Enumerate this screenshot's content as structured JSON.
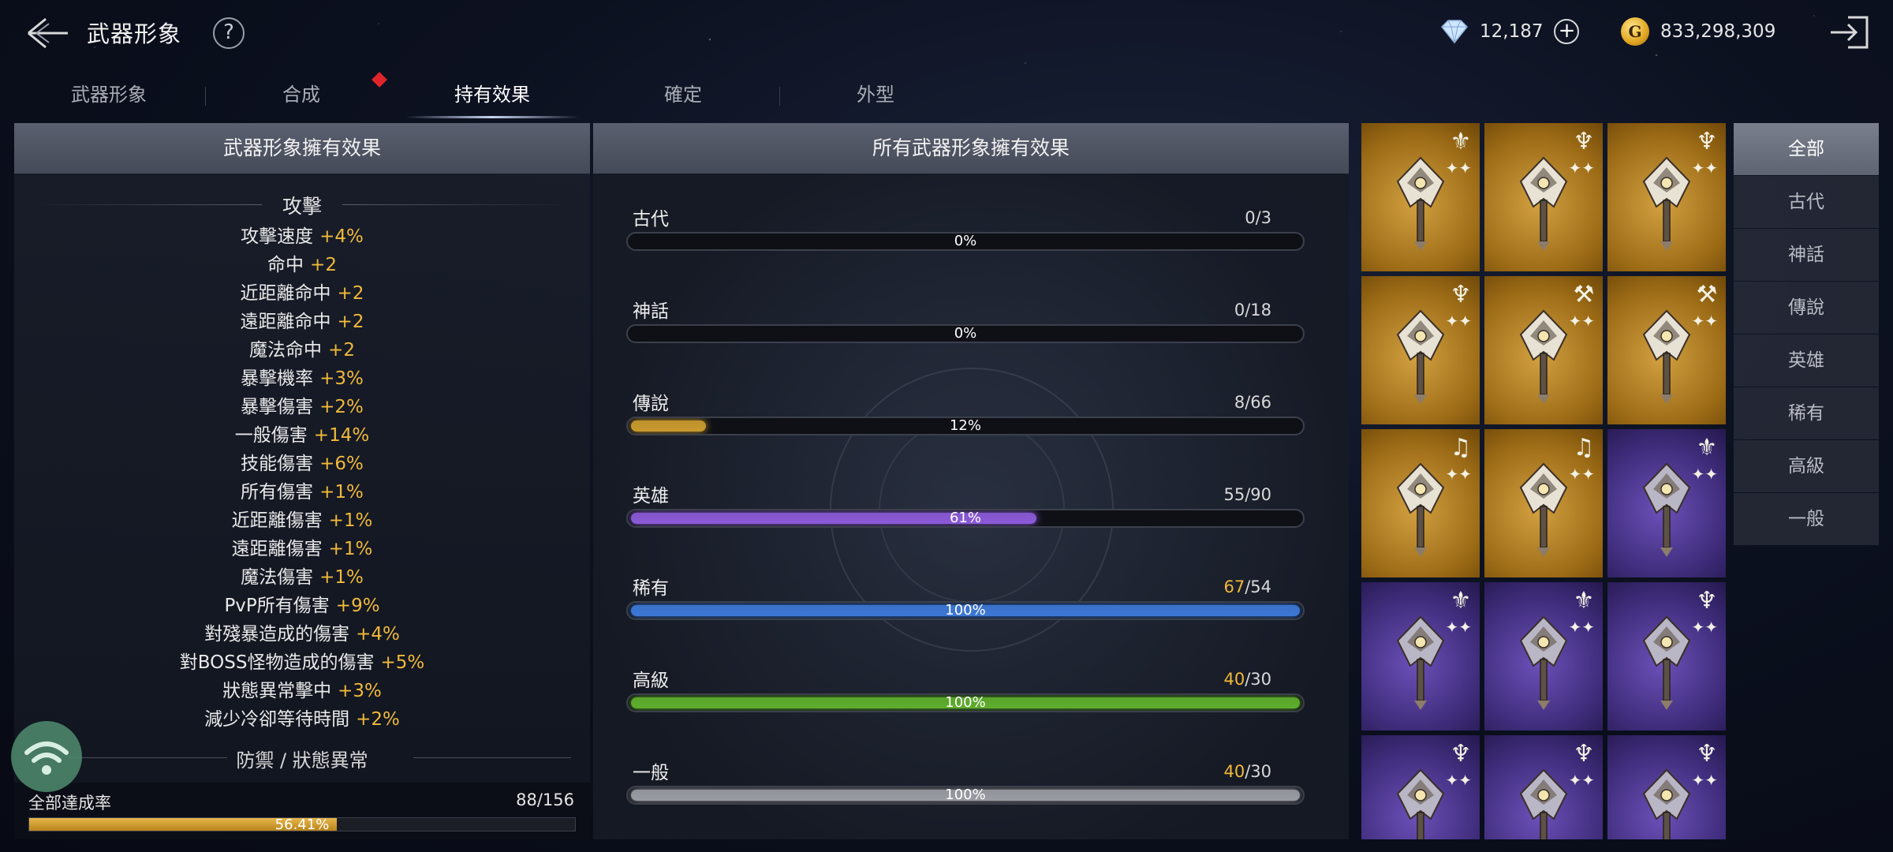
{
  "header": {
    "title": "武器形象",
    "help": "?",
    "diamonds": "12,187",
    "plus": "+",
    "gold_symbol": "G",
    "gold": "833,298,309"
  },
  "tabs": [
    {
      "label": "武器形象"
    },
    {
      "label": "合成"
    },
    {
      "label": "持有效果"
    },
    {
      "label": "確定"
    },
    {
      "label": "外型"
    }
  ],
  "left": {
    "header": "武器形象擁有效果",
    "section_attack": "攻擊",
    "stats": [
      {
        "name": "攻擊速度",
        "value": "+4%"
      },
      {
        "name": "命中",
        "value": "+2"
      },
      {
        "name": "近距離命中",
        "value": "+2"
      },
      {
        "name": "遠距離命中",
        "value": "+2"
      },
      {
        "name": "魔法命中",
        "value": "+2"
      },
      {
        "name": "暴擊機率",
        "value": "+3%"
      },
      {
        "name": "暴擊傷害",
        "value": "+2%"
      },
      {
        "name": "一般傷害",
        "value": "+14%"
      },
      {
        "name": "技能傷害",
        "value": "+6%"
      },
      {
        "name": "所有傷害",
        "value": "+1%"
      },
      {
        "name": "近距離傷害",
        "value": "+1%"
      },
      {
        "name": "遠距離傷害",
        "value": "+1%"
      },
      {
        "name": "魔法傷害",
        "value": "+1%"
      },
      {
        "name": "PvP所有傷害",
        "value": "+9%"
      },
      {
        "name": "對殘暴造成的傷害",
        "value": "+4%"
      },
      {
        "name": "對BOSS怪物造成的傷害",
        "value": "+5%"
      },
      {
        "name": "狀態異常擊中",
        "value": "+3%"
      },
      {
        "name": "減少冷卻等待時間",
        "value": "+2%"
      }
    ],
    "section_defense": "防禦 / 狀態異常",
    "overall_label": "全部達成率",
    "overall_count": "88/156",
    "overall_pct_text": "56.41%",
    "overall_fraction": 0.5641
  },
  "middle": {
    "header": "所有武器形象擁有效果",
    "rarities": [
      {
        "name": "古代",
        "have": "0",
        "total": "/3",
        "pct": "0%",
        "fill": 0,
        "color": "#000000"
      },
      {
        "name": "神話",
        "have": "0",
        "total": "/18",
        "pct": "0%",
        "fill": 0,
        "color": "#000000"
      },
      {
        "name": "傳說",
        "have": "8",
        "total": "/66",
        "pct": "12%",
        "fill": 0.12,
        "color": "#c99a2e"
      },
      {
        "name": "英雄",
        "have": "55",
        "total": "/90",
        "pct": "61%",
        "fill": 0.61,
        "color": "#8c5ad8"
      },
      {
        "name": "稀有",
        "have": "67",
        "total": "/54",
        "pct": "100%",
        "fill": 1,
        "color": "#3d78d6",
        "over": true
      },
      {
        "name": "高級",
        "have": "40",
        "total": "/30",
        "pct": "100%",
        "fill": 1,
        "color": "#5fae2c",
        "over": true
      },
      {
        "name": "一般",
        "have": "40",
        "total": "/30",
        "pct": "100%",
        "fill": 1,
        "color": "#9a9ca3",
        "over": true
      }
    ]
  },
  "grid": {
    "cells": [
      {
        "bg": "gold",
        "badge": "pendant-icon"
      },
      {
        "bg": "gold",
        "badge": "dragonfly-icon"
      },
      {
        "bg": "gold",
        "badge": "dragonfly-icon"
      },
      {
        "bg": "gold",
        "badge": "dragonfly-icon"
      },
      {
        "bg": "gold",
        "badge": "axe-icon"
      },
      {
        "bg": "gold",
        "badge": "axe-icon"
      },
      {
        "bg": "gold",
        "badge": "lyre-icon"
      },
      {
        "bg": "gold",
        "badge": "lyre-icon"
      },
      {
        "bg": "purple",
        "badge": "pendant-icon"
      },
      {
        "bg": "purple",
        "badge": "pendant-icon"
      },
      {
        "bg": "purple",
        "badge": "pendant-icon"
      },
      {
        "bg": "purple",
        "badge": "dragonfly-icon"
      },
      {
        "bg": "purple",
        "badge": "dragonfly-icon"
      },
      {
        "bg": "purple",
        "badge": "dragonfly-icon"
      },
      {
        "bg": "purple",
        "badge": "dragonfly-icon"
      }
    ]
  },
  "filters": [
    {
      "label": "全部"
    },
    {
      "label": "古代"
    },
    {
      "label": "神話"
    },
    {
      "label": "傳說"
    },
    {
      "label": "英雄"
    },
    {
      "label": "稀有"
    },
    {
      "label": "高級"
    },
    {
      "label": "一般"
    }
  ]
}
